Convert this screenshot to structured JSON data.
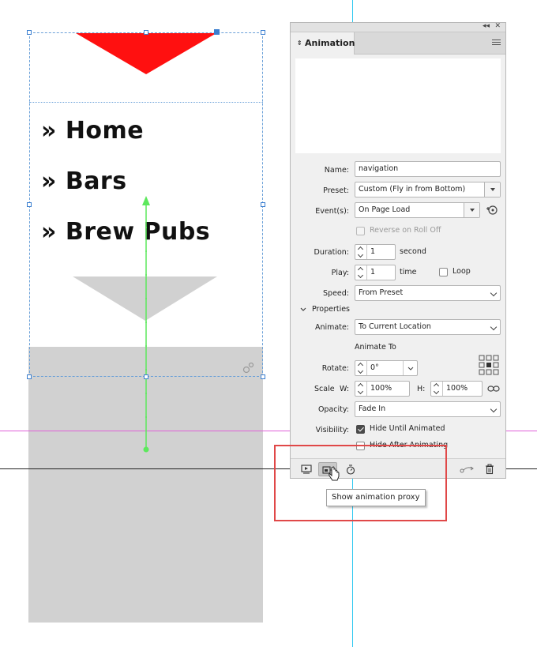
{
  "page": {
    "nav_items": [
      "» Home",
      "» Bars",
      "» Brew Pubs"
    ]
  },
  "panel": {
    "tab_label": "Animation",
    "collapse_glyph": "◂◂",
    "close_glyph": "✕",
    "fields": {
      "name_label": "Name:",
      "name_value": "navigation",
      "preset_label": "Preset:",
      "preset_value": "Custom (Fly in from Bottom)",
      "events_label": "Event(s):",
      "events_value": "On Page Load",
      "reverse_label": "Reverse on Roll Off",
      "duration_label": "Duration:",
      "duration_value": "1",
      "duration_unit": "second",
      "play_label": "Play:",
      "play_value": "1",
      "play_unit": "time",
      "loop_label": "Loop",
      "speed_label": "Speed:",
      "speed_value": "From Preset"
    },
    "properties": {
      "section_label": "Properties",
      "animate_label": "Animate:",
      "animate_value": "To Current Location",
      "animate_to_label": "Animate To",
      "rotate_label": "Rotate:",
      "rotate_value": "0°",
      "scale_label": "Scale",
      "w_label": "W:",
      "w_value": "100%",
      "h_label": "H:",
      "h_value": "100%",
      "opacity_label": "Opacity:",
      "opacity_value": "Fade In",
      "visibility_label": "Visibility:",
      "hide_until_label": "Hide Until Animated",
      "hide_until_checked": true,
      "hide_after_label": "Hide After Animating",
      "hide_after_checked": false
    },
    "bottom_bar": {
      "tooltip": "Show animation proxy"
    }
  },
  "colors": {
    "red_shape": "#ff1010",
    "gray_shape": "#d1d1d1",
    "motion_path": "#5de85d",
    "guide_cyan": "#2ec8f0",
    "guide_magenta": "#e060d8",
    "highlight_box": "#e04848",
    "selection": "#3b7fd0"
  },
  "icons": [
    "collapse-icon",
    "close-icon",
    "panel-menu-icon",
    "event-add-icon",
    "chevron-down-icon",
    "link-icon",
    "preview-animation-icon",
    "show-proxy-icon",
    "timing-icon",
    "motion-path-icon",
    "trash-icon",
    "reference-point-icon"
  ]
}
